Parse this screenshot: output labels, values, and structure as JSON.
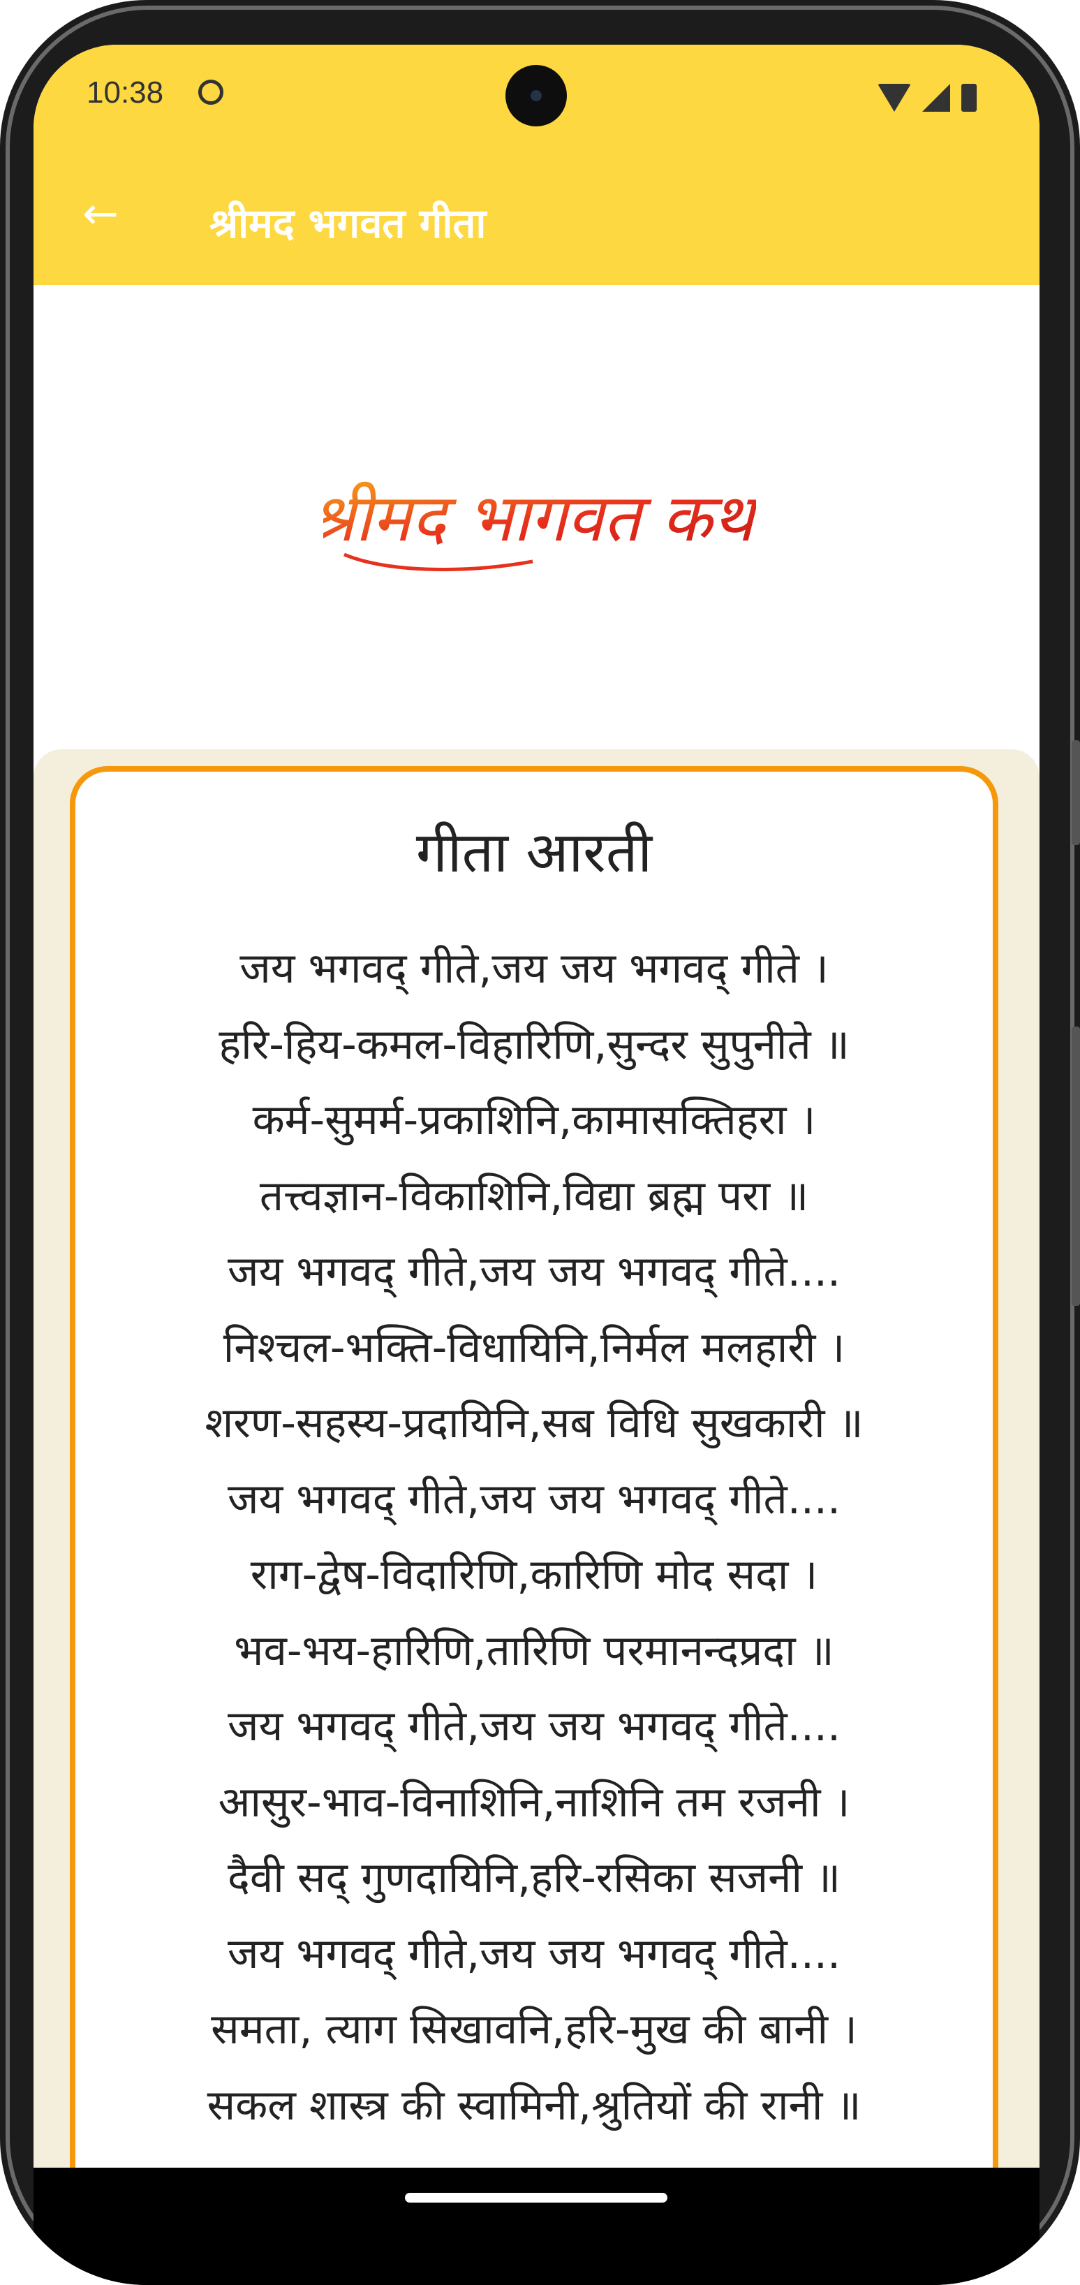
{
  "status_bar": {
    "time": "10:38"
  },
  "app_bar": {
    "title": "श्रीमद भगवत गीता"
  },
  "logo": {
    "text": "श्रीमद भागवत कथा"
  },
  "card": {
    "title": "गीता आरती",
    "verses": [
      "जय भगवद् गीते,जय जय भगवद् गीते ।",
      "हरि-हिय-कमल-विहारिणि,सुन्दर सुपुनीते ॥",
      "कर्म-सुमर्म-प्रकाशिनि,कामासक्तिहरा ।",
      "तत्त्वज्ञान-विकाशिनि,विद्या ब्रह्म परा ॥",
      "जय भगवद् गीते,जय जय भगवद् गीते....",
      "निश्चल-भक्ति-विधायिनि,निर्मल मलहारी ।",
      "शरण-सहस्य-प्रदायिनि,सब विधि सुखकारी ॥",
      "जय भगवद् गीते,जय जय भगवद् गीते....",
      "राग-द्वेष-विदारिणि,कारिणि मोद सदा ।",
      "भव-भय-हारिणि,तारिणि परमानन्दप्रदा ॥",
      "जय भगवद् गीते,जय जय भगवद् गीते....",
      "आसुर-भाव-विनाशिनि,नाशिनि तम रजनी ।",
      "दैवी सद् गुणदायिनि,हरि-रसिका सजनी ॥",
      "जय भगवद् गीते,जय जय भगवद् गीते....",
      "समता, त्याग सिखावनि,हरि-मुख की बानी ।",
      "सकल शास्त्र की स्वामिनी,श्रुतियों की रानी ॥"
    ]
  },
  "colors": {
    "accent": "#fed840",
    "border": "#f6980c",
    "card_bg": "#f3efdc"
  }
}
